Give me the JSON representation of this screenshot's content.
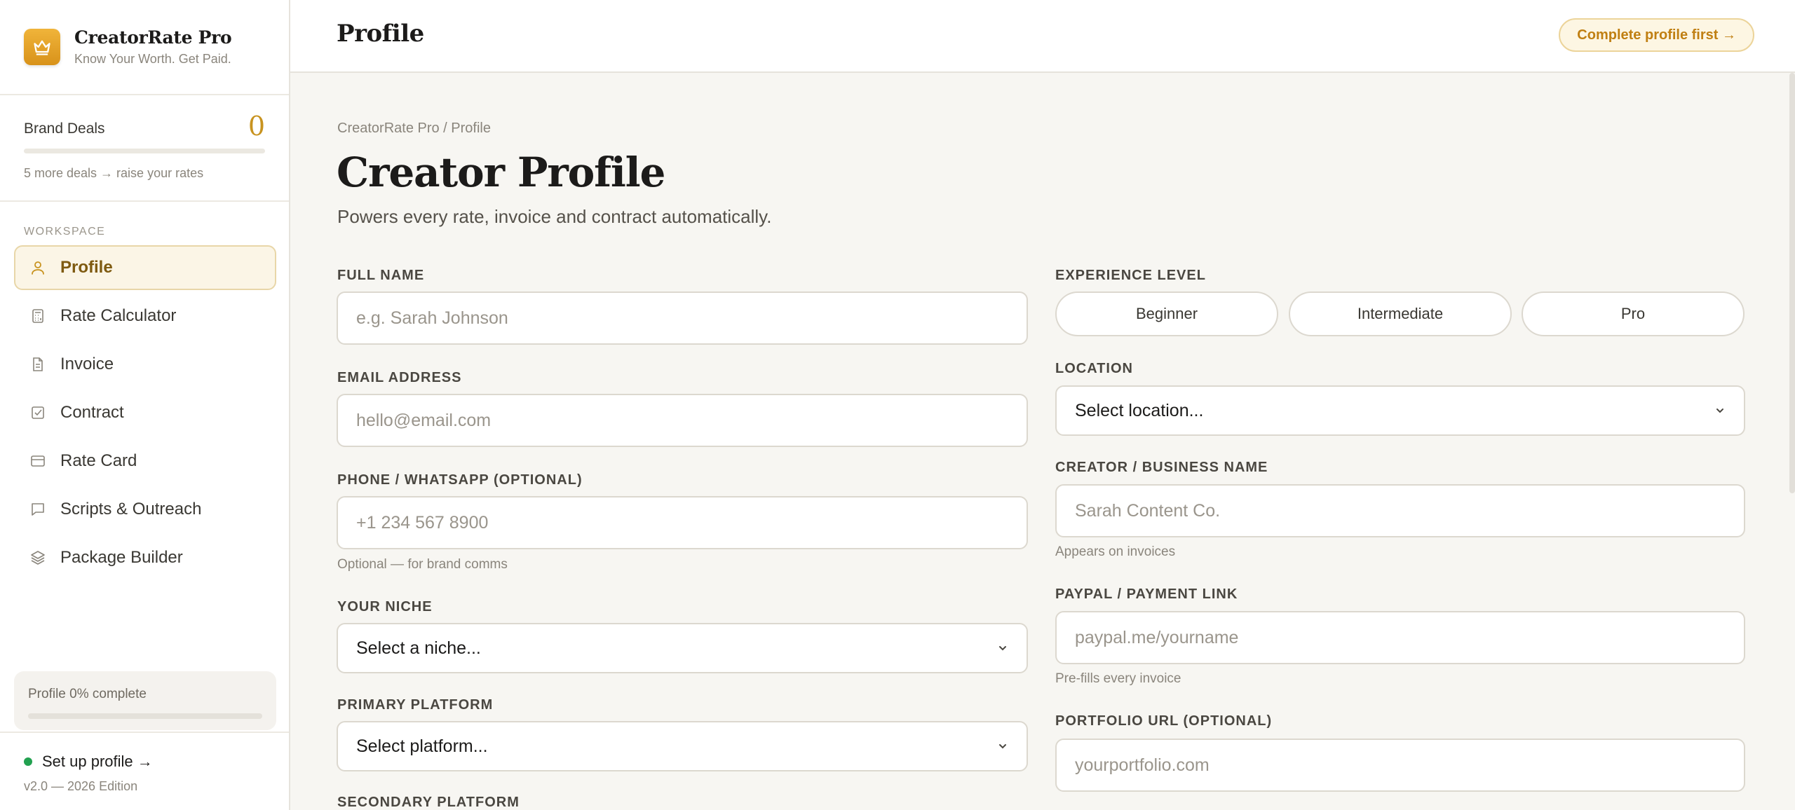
{
  "app": {
    "name": "CreatorRate Pro",
    "tagline": "Know Your Worth. Get Paid."
  },
  "deals": {
    "label": "Brand Deals",
    "count": "0",
    "progress": 0,
    "hint": "5 more deals → raise your rates"
  },
  "sidebar": {
    "section_label": "WORKSPACE",
    "items": [
      {
        "label": "Profile",
        "icon": "user-icon",
        "active": true
      },
      {
        "label": "Rate Calculator",
        "icon": "calculator-icon"
      },
      {
        "label": "Invoice",
        "icon": "document-icon"
      },
      {
        "label": "Contract",
        "icon": "checkbox-icon"
      },
      {
        "label": "Rate Card",
        "icon": "card-icon"
      },
      {
        "label": "Scripts & Outreach",
        "icon": "chat-icon"
      },
      {
        "label": "Package Builder",
        "icon": "layers-icon"
      }
    ],
    "completion_label": "Profile 0% complete",
    "completion_progress": 0,
    "setup_label": "Set up profile →",
    "version": "v2.0 — 2026 Edition"
  },
  "header": {
    "title": "Profile",
    "cta_label": "Complete profile first →"
  },
  "main": {
    "breadcrumb": "CreatorRate Pro / Profile",
    "title": "Creator Profile",
    "subtitle": "Powers every rate, invoice and contract automatically."
  },
  "form": {
    "full_name": {
      "label": "FULL NAME",
      "placeholder": "e.g. Sarah Johnson"
    },
    "email": {
      "label": "EMAIL ADDRESS",
      "placeholder": "hello@email.com"
    },
    "phone": {
      "label": "PHONE / WHATSAPP (OPTIONAL)",
      "placeholder": "+1 234 567 8900",
      "hint": "Optional — for brand comms"
    },
    "niche": {
      "label": "YOUR NICHE",
      "value": "Select a niche..."
    },
    "primary_platform": {
      "label": "PRIMARY PLATFORM",
      "value": "Select platform..."
    },
    "secondary_platform": {
      "label": "SECONDARY PLATFORM"
    },
    "experience": {
      "label": "EXPERIENCE LEVEL",
      "options": [
        "Beginner",
        "Intermediate",
        "Pro"
      ]
    },
    "location": {
      "label": "LOCATION",
      "value": "Select location..."
    },
    "business_name": {
      "label": "CREATOR / BUSINESS NAME",
      "placeholder": "Sarah Content Co.",
      "hint": "Appears on invoices"
    },
    "payment_link": {
      "label": "PAYPAL / PAYMENT LINK",
      "placeholder": "paypal.me/yourname",
      "hint": "Pre-fills every invoice"
    },
    "portfolio": {
      "label": "PORTFOLIO URL (OPTIONAL)",
      "placeholder": "yourportfolio.com"
    }
  },
  "colors": {
    "accent": "#c8931f",
    "status_dot": "#22a150"
  }
}
